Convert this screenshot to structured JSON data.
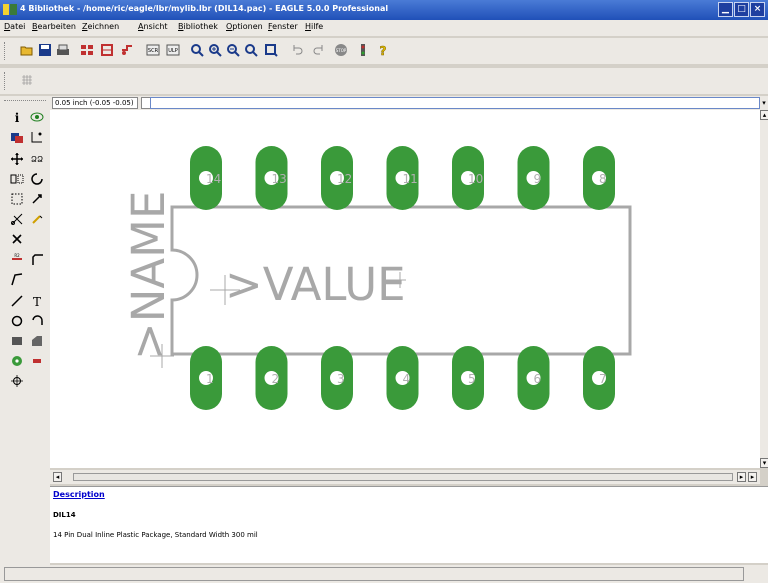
{
  "window": {
    "title": "4 Bibliothek - /home/ric/eagle/lbr/mylib.lbr (DIL14.pac) - EAGLE 5.0.0 Professional",
    "controls": {
      "minimize": "▁",
      "maximize": "□",
      "close": "×"
    }
  },
  "menu": {
    "items": [
      "Datei",
      "Bearbeiten",
      "Zeichnen",
      "Ansicht",
      "Bibliothek",
      "Optionen",
      "Fenster",
      "Hilfe"
    ]
  },
  "toolbar": {
    "icons": [
      "open-icon",
      "save-icon",
      "print-icon",
      "cam-icon",
      "board-icon",
      "drc-icon",
      "script-icon",
      "ulp-icon",
      "zoom-fit-icon",
      "zoom-in-icon",
      "zoom-out-icon",
      "zoom-redraw-icon",
      "zoom-select-icon",
      "undo-icon",
      "redo-icon",
      "stop-icon",
      "go-icon",
      "help-icon"
    ]
  },
  "command_bar": {
    "coordinate": "0.05 inch (-0.05 -0.05)",
    "command_value": "",
    "dropdown": "▾"
  },
  "package": {
    "name_label": ">NAME",
    "value_label": ">VALUE",
    "top_pins": [
      "14",
      "13",
      "12",
      "11",
      "10",
      "9",
      "8"
    ],
    "bottom_pins": [
      "1",
      "2",
      "3",
      "4",
      "5",
      "6",
      "7"
    ],
    "pad_color": "#3a9a3a",
    "outline_color": "#a8a8a8"
  },
  "description": {
    "link": "Description",
    "name": "DIL14",
    "text": "14 Pin Dual Inline Plastic Package, Standard Width 300 mil"
  },
  "scrollbar": {
    "left_arrow": "◂",
    "right_arrow": "▸",
    "up_arrow": "▴",
    "down_arrow": "▾"
  },
  "status": {
    "text": ""
  }
}
